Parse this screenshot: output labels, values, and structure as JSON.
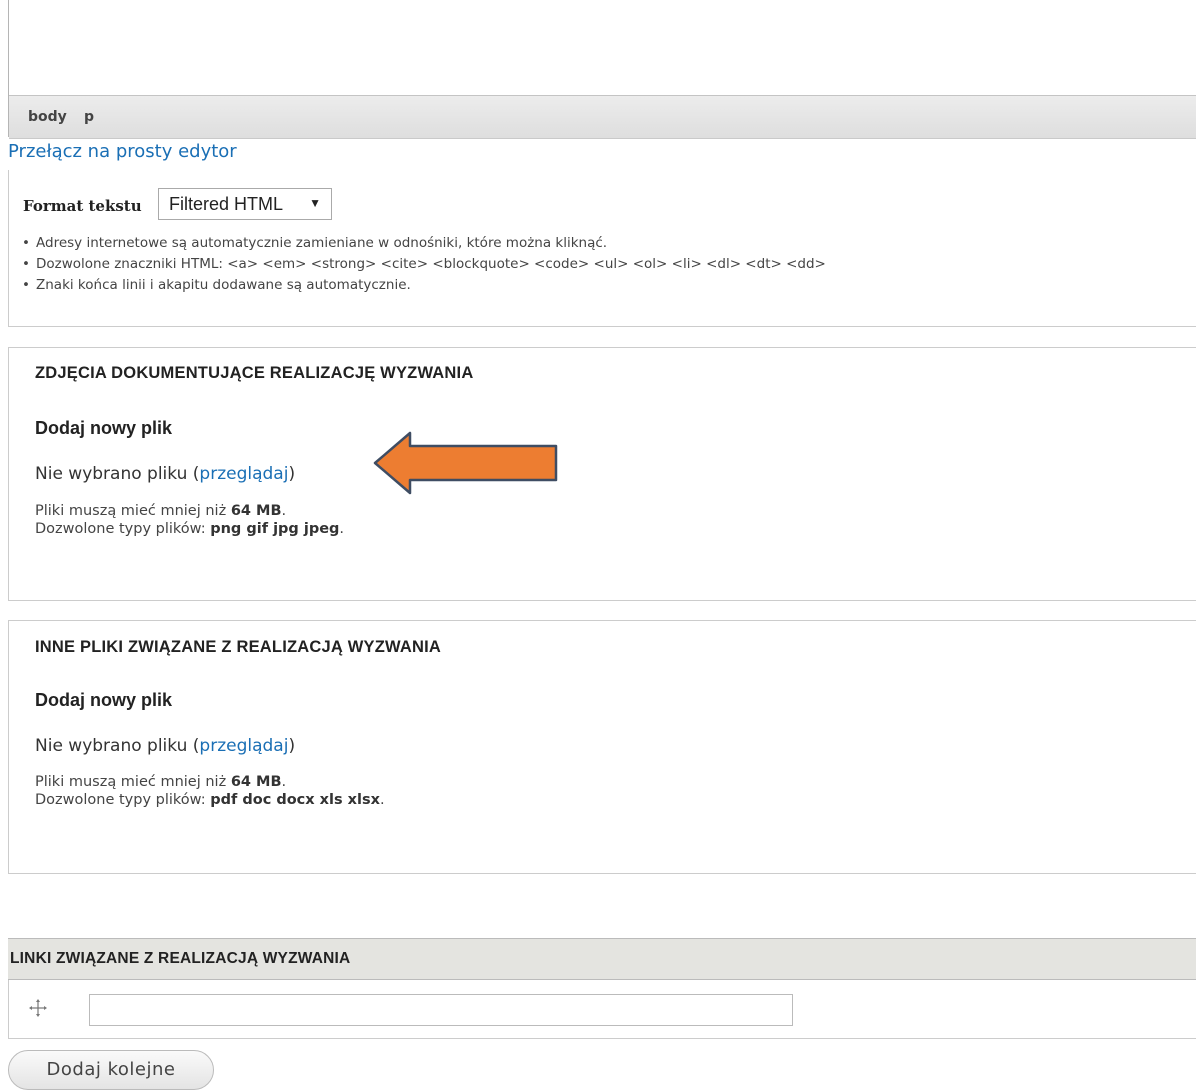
{
  "editor": {
    "path": [
      "body",
      "p"
    ],
    "switch_link": "Przełącz na prosty edytor"
  },
  "format": {
    "label": "Format tekstu",
    "selected": "Filtered HTML",
    "tips": [
      "Adresy internetowe są automatycznie zamieniane w odnośniki, które można kliknąć.",
      "Dozwolone znaczniki HTML: <a> <em> <strong> <cite> <blockquote> <code> <ul> <ol> <li> <dl> <dt> <dd>",
      "Znaki końca linii i akapitu dodawane są automatycznie."
    ]
  },
  "photos": {
    "legend": "ZDJĘCIA DOKUMENTUJĄCE REALIZACJĘ WYZWANIA",
    "add_label": "Dodaj nowy plik",
    "no_file": "Nie wybrano pliku (",
    "browse": "przeglądaj",
    "close_paren": ")",
    "size_prefix": "Pliki muszą mieć mniej niż ",
    "size_value": "64 MB",
    "types_prefix": "Dozwolone typy plików: ",
    "types_value": "png gif jpg jpeg",
    "dot": "."
  },
  "other_files": {
    "legend": "INNE PLIKI ZWIĄZANE Z REALIZACJĄ WYZWANIA",
    "add_label": "Dodaj nowy plik",
    "no_file": "Nie wybrano pliku (",
    "browse": "przeglądaj",
    "close_paren": ")",
    "size_prefix": "Pliki muszą mieć mniej niż ",
    "size_value": "64 MB",
    "types_prefix": "Dozwolone typy plików: ",
    "types_value": "pdf doc docx xls xlsx",
    "dot": "."
  },
  "links": {
    "legend": "LINKI ZWIĄZANE Z REALIZACJĄ WYZWANIA",
    "input_value": "",
    "add_button": "Dodaj kolejne"
  },
  "colors": {
    "arrow_fill": "#ed7d31",
    "arrow_stroke": "#3f4d63",
    "link": "#1a6fb5"
  },
  "icons": {
    "drag": "drag-handle-icon",
    "select": "chevron-down-icon",
    "annotation": "left-arrow-annotation"
  }
}
